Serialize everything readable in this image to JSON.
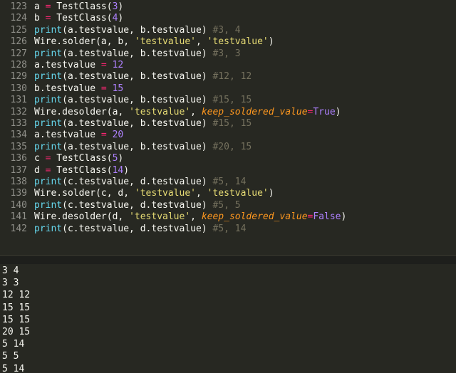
{
  "editor": {
    "lines": [
      {
        "no": "123",
        "tokens": [
          {
            "t": "a ",
            "c": ""
          },
          {
            "t": "=",
            "c": "op"
          },
          {
            "t": " TestClass(",
            "c": ""
          },
          {
            "t": "3",
            "c": "num"
          },
          {
            "t": ")",
            "c": ""
          }
        ]
      },
      {
        "no": "124",
        "tokens": [
          {
            "t": "b ",
            "c": ""
          },
          {
            "t": "=",
            "c": "op"
          },
          {
            "t": " TestClass(",
            "c": ""
          },
          {
            "t": "4",
            "c": "num"
          },
          {
            "t": ")",
            "c": ""
          }
        ]
      },
      {
        "no": "125",
        "tokens": [
          {
            "t": "print",
            "c": "kw"
          },
          {
            "t": "(a.testvalue, b.testvalue) ",
            "c": ""
          },
          {
            "t": "#3, 4",
            "c": "cm"
          }
        ]
      },
      {
        "no": "126",
        "tokens": [
          {
            "t": "Wire.solder(a, b, ",
            "c": ""
          },
          {
            "t": "'testvalue'",
            "c": "str"
          },
          {
            "t": ", ",
            "c": ""
          },
          {
            "t": "'testvalue'",
            "c": "str"
          },
          {
            "t": ")",
            "c": ""
          }
        ]
      },
      {
        "no": "127",
        "tokens": [
          {
            "t": "print",
            "c": "kw"
          },
          {
            "t": "(a.testvalue, b.testvalue) ",
            "c": ""
          },
          {
            "t": "#3, 3",
            "c": "cm"
          }
        ]
      },
      {
        "no": "128",
        "tokens": [
          {
            "t": "a.testvalue ",
            "c": ""
          },
          {
            "t": "=",
            "c": "op"
          },
          {
            "t": " ",
            "c": ""
          },
          {
            "t": "12",
            "c": "num"
          }
        ]
      },
      {
        "no": "129",
        "tokens": [
          {
            "t": "print",
            "c": "kw"
          },
          {
            "t": "(a.testvalue, b.testvalue) ",
            "c": ""
          },
          {
            "t": "#12, 12",
            "c": "cm"
          }
        ]
      },
      {
        "no": "130",
        "tokens": [
          {
            "t": "b.testvalue ",
            "c": ""
          },
          {
            "t": "=",
            "c": "op"
          },
          {
            "t": " ",
            "c": ""
          },
          {
            "t": "15",
            "c": "num"
          }
        ]
      },
      {
        "no": "131",
        "tokens": [
          {
            "t": "print",
            "c": "kw"
          },
          {
            "t": "(a.testvalue, b.testvalue) ",
            "c": ""
          },
          {
            "t": "#15, 15",
            "c": "cm"
          }
        ]
      },
      {
        "no": "132",
        "tokens": [
          {
            "t": "Wire.desolder(a, ",
            "c": ""
          },
          {
            "t": "'testvalue'",
            "c": "str"
          },
          {
            "t": ", ",
            "c": ""
          },
          {
            "t": "keep_soldered_value",
            "c": "param"
          },
          {
            "t": "=",
            "c": "op"
          },
          {
            "t": "True",
            "c": "const"
          },
          {
            "t": ")",
            "c": ""
          }
        ]
      },
      {
        "no": "133",
        "tokens": [
          {
            "t": "print",
            "c": "kw"
          },
          {
            "t": "(a.testvalue, b.testvalue) ",
            "c": ""
          },
          {
            "t": "#15, 15",
            "c": "cm"
          }
        ]
      },
      {
        "no": "134",
        "tokens": [
          {
            "t": "a.testvalue ",
            "c": ""
          },
          {
            "t": "=",
            "c": "op"
          },
          {
            "t": " ",
            "c": ""
          },
          {
            "t": "20",
            "c": "num"
          }
        ]
      },
      {
        "no": "135",
        "tokens": [
          {
            "t": "print",
            "c": "kw"
          },
          {
            "t": "(a.testvalue, b.testvalue) ",
            "c": ""
          },
          {
            "t": "#20, 15",
            "c": "cm"
          }
        ]
      },
      {
        "no": "136",
        "tokens": [
          {
            "t": "c ",
            "c": ""
          },
          {
            "t": "=",
            "c": "op"
          },
          {
            "t": " TestClass(",
            "c": ""
          },
          {
            "t": "5",
            "c": "num"
          },
          {
            "t": ")",
            "c": ""
          }
        ]
      },
      {
        "no": "137",
        "tokens": [
          {
            "t": "d ",
            "c": ""
          },
          {
            "t": "=",
            "c": "op"
          },
          {
            "t": " TestClass(",
            "c": ""
          },
          {
            "t": "14",
            "c": "num"
          },
          {
            "t": ")",
            "c": ""
          }
        ]
      },
      {
        "no": "138",
        "tokens": [
          {
            "t": "print",
            "c": "kw"
          },
          {
            "t": "(c.testvalue, d.testvalue) ",
            "c": ""
          },
          {
            "t": "#5, 14",
            "c": "cm"
          }
        ]
      },
      {
        "no": "139",
        "tokens": [
          {
            "t": "Wire.solder(c, d, ",
            "c": ""
          },
          {
            "t": "'testvalue'",
            "c": "str"
          },
          {
            "t": ", ",
            "c": ""
          },
          {
            "t": "'testvalue'",
            "c": "str"
          },
          {
            "t": ")",
            "c": ""
          }
        ]
      },
      {
        "no": "140",
        "tokens": [
          {
            "t": "print",
            "c": "kw"
          },
          {
            "t": "(c.testvalue, d.testvalue) ",
            "c": ""
          },
          {
            "t": "#5, 5",
            "c": "cm"
          }
        ]
      },
      {
        "no": "141",
        "tokens": [
          {
            "t": "Wire.desolder(d, ",
            "c": ""
          },
          {
            "t": "'testvalue'",
            "c": "str"
          },
          {
            "t": ", ",
            "c": ""
          },
          {
            "t": "keep_soldered_value",
            "c": "param"
          },
          {
            "t": "=",
            "c": "op"
          },
          {
            "t": "False",
            "c": "const"
          },
          {
            "t": ")",
            "c": ""
          }
        ]
      },
      {
        "no": "142",
        "tokens": [
          {
            "t": "print",
            "c": "kw"
          },
          {
            "t": "(c.testvalue, d.testvalue) ",
            "c": ""
          },
          {
            "t": "#5, 14",
            "c": "cm"
          }
        ]
      }
    ]
  },
  "output": {
    "lines": [
      "3 4",
      "3 3",
      "12 12",
      "15 15",
      "15 15",
      "20 15",
      "5 14",
      "5 5",
      "5 14"
    ]
  },
  "colors": {
    "background": "#272822",
    "keyword": "#66d9ef",
    "number": "#ae81ff",
    "string": "#e6db74",
    "comment": "#75715e",
    "operator": "#f92672",
    "parameter": "#fd971f"
  }
}
